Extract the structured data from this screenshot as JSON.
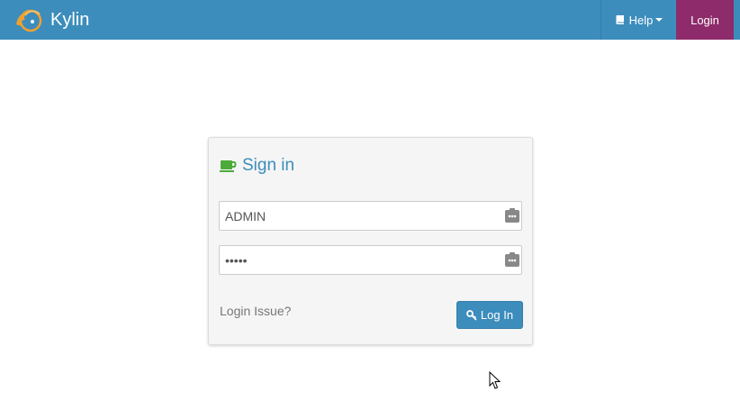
{
  "navbar": {
    "brand": "Kylin",
    "help_label": "Help",
    "login_label": "Login",
    "colors": {
      "bar": "#3c8dbc",
      "login_active": "#8e2b6a"
    }
  },
  "login_box": {
    "title": "Sign in",
    "title_icon": "coffee-icon",
    "username": {
      "value": "ADMIN",
      "icon": "contact-card-icon"
    },
    "password": {
      "value": "•••••",
      "icon": "contact-card-icon"
    },
    "issue_link": "Login Issue?",
    "login_button": "Log In",
    "button_icon": "key-icon"
  }
}
